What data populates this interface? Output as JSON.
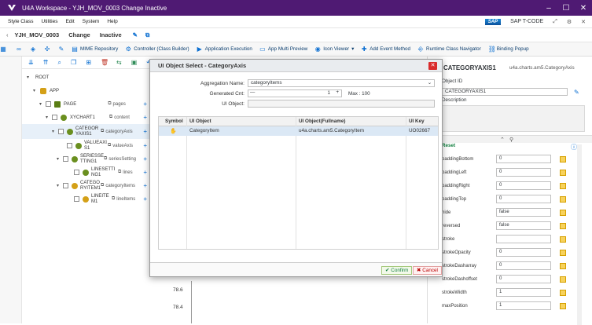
{
  "window": {
    "title": "U4A Workspace - YJH_MOV_0003 Change Inactive"
  },
  "menu": [
    "Style Class",
    "Utilities",
    "Edit",
    "System",
    "Help"
  ],
  "sap": {
    "logo": "SAP",
    "tcode_label": "SAP T-CODE"
  },
  "header": {
    "app_id": "YJH_MOV_0003",
    "mode": "Change",
    "status": "Inactive"
  },
  "toolbar": [
    "MIME Repository",
    "Controller (Class Builder)",
    "Application Execution",
    "App Multi Preview",
    "Icon Viewer",
    "Add Event Method",
    "Runtime Class Navigator",
    "Binding Popup"
  ],
  "tree": {
    "root": "ROOT",
    "app": "APP",
    "page": "PAGE",
    "page_agg": "pages",
    "xychart": "XYCHART1",
    "xychart_agg": "content",
    "cataxis": "CATEGORYAXIS1",
    "cataxis_agg": "categoryAxis",
    "valueaxis": "VALUEAXIS1",
    "valueaxis_agg": "valueAxis",
    "series": "SERIESSETTING1",
    "series_agg": "seriesSetting",
    "lineset": "LINESETTING1",
    "lineset_agg": "lines",
    "catitem": "CATEGORYITEM1",
    "catitem_agg": "categoryItems",
    "lineitem": "LINEITEM1",
    "lineitem_agg": "lineItems"
  },
  "chart_values": [
    "78.6",
    "78.4"
  ],
  "right": {
    "title": "CATEGORYAXIS1",
    "class": "u4a.charts.am5.CategoryAxis",
    "object_id_label": "Object ID",
    "object_id": "CATEGORYAXIS1",
    "desc_label": "Description",
    "reset": "Reset",
    "props": [
      {
        "name": "paddingBottom",
        "value": "0"
      },
      {
        "name": "paddingLeft",
        "value": "0"
      },
      {
        "name": "paddingRight",
        "value": "0"
      },
      {
        "name": "paddingTop",
        "value": "0"
      },
      {
        "name": "hide",
        "value": "false"
      },
      {
        "name": "reversed",
        "value": "false"
      },
      {
        "name": "stroke",
        "value": ""
      },
      {
        "name": "strokeOpacity",
        "value": "0"
      },
      {
        "name": "strokeDasharray",
        "value": "0"
      },
      {
        "name": "strokeDashoffset",
        "value": "0"
      },
      {
        "name": "strokeWidth",
        "value": "1"
      },
      {
        "name": "maxPosition",
        "value": "1"
      }
    ]
  },
  "modal": {
    "title": "UI Object Select - CategoryAxis",
    "agg_label": "Aggregation Name:",
    "agg_value": "categoryItems",
    "gen_label": "Generated Cnt:",
    "gen_value": "1",
    "gen_max": "Max : 100",
    "uiobj_label": "UI Object:",
    "cols": [
      "Symbol",
      "UI Object",
      "UI Object(Fullname)",
      "UI Key"
    ],
    "row": {
      "uiobject": "CategoryItem",
      "fullname": "u4a.charts.am5.CategoryItem",
      "key": "UO02667"
    },
    "confirm": "Confirm",
    "cancel": "Cancel"
  }
}
